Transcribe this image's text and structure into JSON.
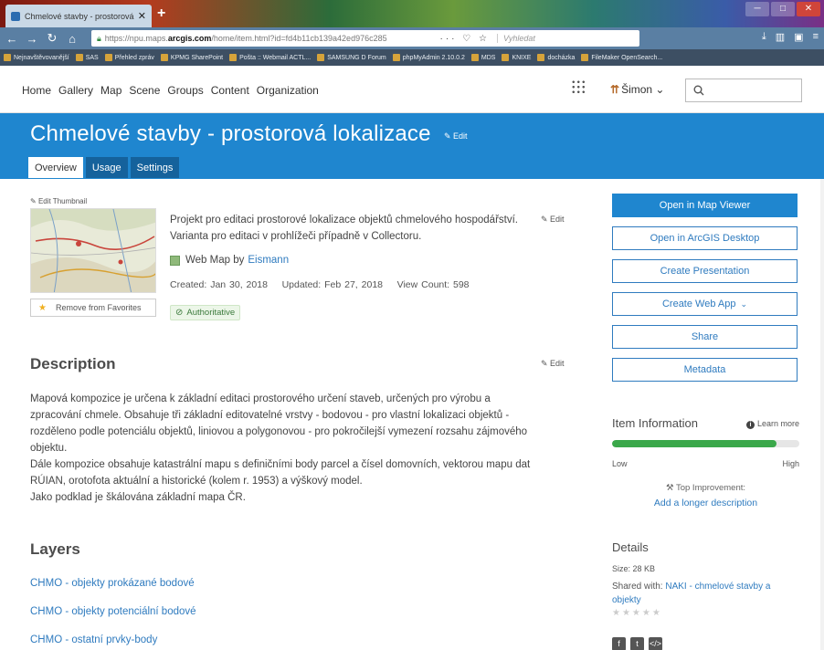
{
  "browser": {
    "tab_title": "Chmelové stavby - prostorová",
    "new_tab": "+",
    "url_prefix": "https://npu.maps.",
    "url_domain": "arcgis.com",
    "url_path": "/home/item.html?id=fd4b11cb139a42ed976c285",
    "url_tools": "··· ♡ ☆",
    "search_placeholder": "Vyhledat",
    "bookmarks": [
      "Nejnavštěvovanější",
      "SAS",
      "Přehled zpráv",
      "KPMG SharePoint",
      "Pošta :: Webmail ACTL...",
      "SAMSUNG D Forum",
      "phpMyAdmin 2.10.0.2",
      "MDS",
      "KNIXE",
      "docházka",
      "FileMaker OpenSearch..."
    ]
  },
  "nav": {
    "links": [
      "Home",
      "Gallery",
      "Map",
      "Scene",
      "Groups",
      "Content",
      "Organization"
    ],
    "user_name": "Šimon"
  },
  "header": {
    "title": "Chmelové stavby - prostorová lokalizace",
    "edit_label": "Edit",
    "tabs": [
      "Overview",
      "Usage",
      "Settings"
    ]
  },
  "overview": {
    "edit_thumbnail": "Edit Thumbnail",
    "remove_favorites": "Remove from Favorites",
    "summary": "Projekt pro editaci prostorové lokalizace objektů chmelového hospodářství. Varianta pro editaci v prohlížeči případně v Collectoru.",
    "summary_edit": "Edit",
    "item_type": "Web Map by",
    "owner": "Eismann",
    "meta": "Created: Jan 30, 2018    Updated: Feb 27, 2018    View Count: 598",
    "authoritative": "Authoritative"
  },
  "description": {
    "heading": "Description",
    "edit": "Edit",
    "lines": [
      "Mapová kompozice je určena k základní editaci prostorového určení staveb, určených pro výrobu a",
      "zpracování chmele. Obsahuje tři základní editovatelné vrstvy - bodovou - pro vlastní lokalizaci objektů -",
      "rozděleno podle potenciálu objektů, liniovou a polygonovou - pro pokročilejší vymezení rozsahu zájmového",
      "objektu.",
      "Dále kompozice obsahuje katastrální mapu s definičními body parcel a čísel domovních, vektorou mapu dat",
      "RÚIAN, orotofota aktuální a historické (kolem r. 1953) a výškový model.",
      "Jako podklad je škálována základní mapa ČR."
    ]
  },
  "layers": {
    "heading": "Layers",
    "items": [
      "CHMO - objekty prokázané bodové",
      "CHMO - objekty potenciální bodové",
      "CHMO - ostatní prvky-body"
    ]
  },
  "sidebar": {
    "buttons": [
      {
        "label": "Open in Map Viewer"
      },
      {
        "label": "Open in ArcGIS Desktop"
      },
      {
        "label": "Create Presentation"
      },
      {
        "label": "Create Web App"
      },
      {
        "label": "Share"
      },
      {
        "label": "Metadata"
      }
    ],
    "item_info": {
      "heading": "Item Information",
      "learn_more": "Learn more",
      "score_fraction": 0.88,
      "low": "Low",
      "high": "High",
      "top_improvement": "Top Improvement:",
      "improvement_link": "Add a longer description"
    },
    "details": {
      "heading": "Details",
      "size": "Size: 28 KB",
      "shared_with_label": "Shared with:",
      "shared_group": "NAKI - chmelové stavby a objekty",
      "rating": "★★★★★"
    }
  },
  "colors": {
    "accent": "#1f86cf",
    "link": "#2f7bbf",
    "progress": "#3aa84a"
  }
}
